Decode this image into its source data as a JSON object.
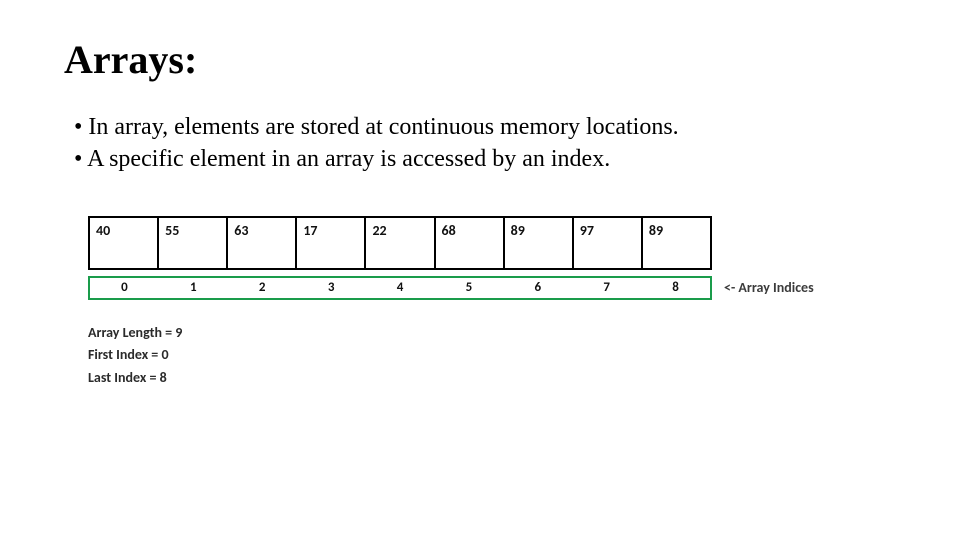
{
  "title": "Arrays:",
  "bullets": [
    "In array, elements are stored at continuous memory locations.",
    "A specific element in an array is accessed by an index."
  ],
  "array": {
    "values": [
      "40",
      "55",
      "63",
      "17",
      "22",
      "68",
      "89",
      "97",
      "89"
    ],
    "indices": [
      "0",
      "1",
      "2",
      "3",
      "4",
      "5",
      "6",
      "7",
      "8"
    ],
    "indices_label": "<- Array Indices"
  },
  "meta": {
    "length": "Array Length = 9",
    "first": "First Index = 0",
    "last": "Last Index = 8"
  }
}
